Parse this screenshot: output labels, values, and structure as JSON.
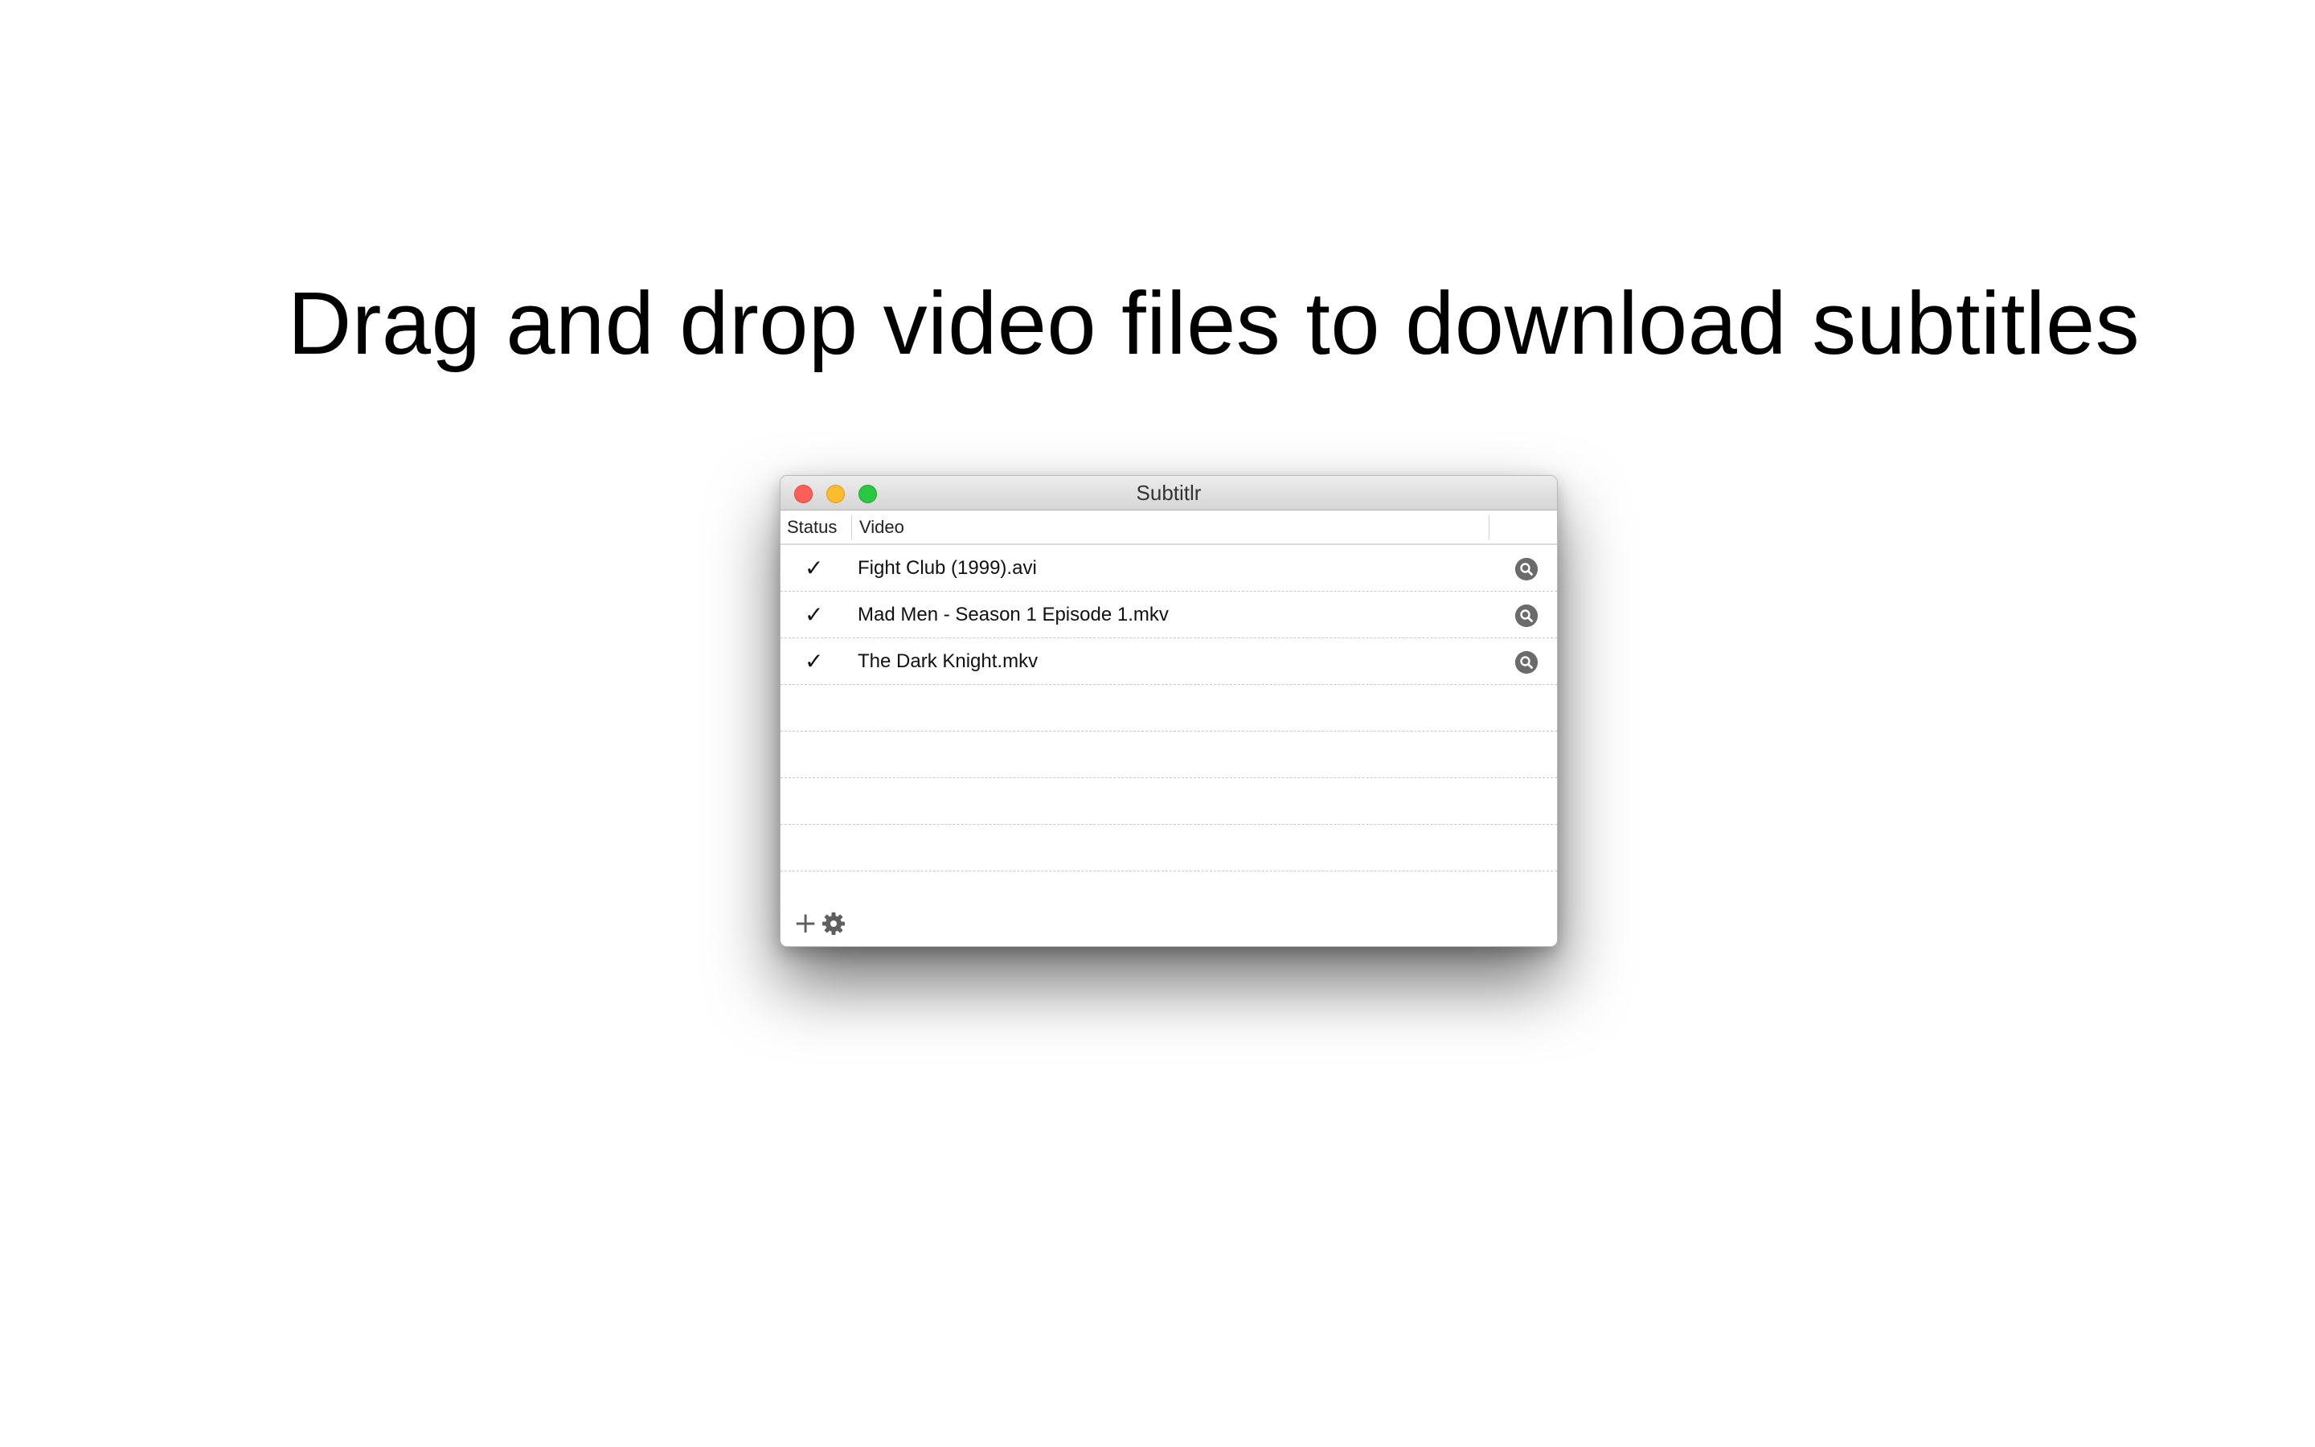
{
  "headline": "Drag and drop video files to download subtitles",
  "window": {
    "title": "Subtitlr",
    "controls": {
      "close": "close-button",
      "minimize": "minimize-button",
      "maximize": "maximize-button"
    },
    "columns": {
      "status": "Status",
      "video": "Video"
    },
    "rows": [
      {
        "status": "✓",
        "video": "Fight Club (1999).avi",
        "action_icon": "search-icon"
      },
      {
        "status": "✓",
        "video": "Mad Men - Season 1 Episode 1.mkv",
        "action_icon": "search-icon"
      },
      {
        "status": "✓",
        "video": "The Dark Knight.mkv",
        "action_icon": "search-icon"
      }
    ],
    "empty_rows": 4,
    "toolbar": {
      "add_label": "+",
      "add_icon": "plus-icon",
      "settings_icon": "gear-icon"
    }
  },
  "colors": {
    "close": "#fc5f57",
    "minimize": "#fdbc2e",
    "maximize": "#2ac840",
    "icon_gray": "#6b6b6b"
  }
}
